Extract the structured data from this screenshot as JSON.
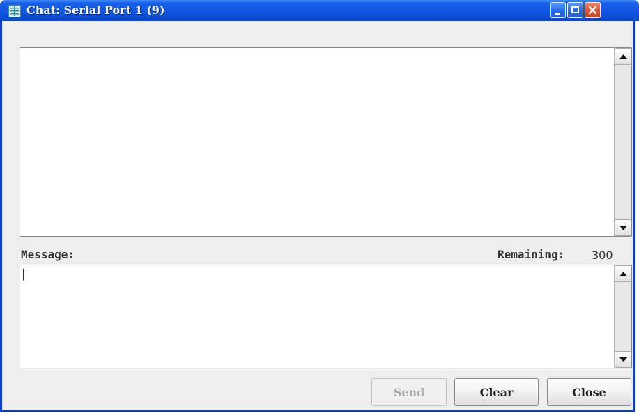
{
  "window": {
    "title": "Chat: Serial Port 1 (9)",
    "controls": [
      "minimize-icon",
      "maximize-icon",
      "close-icon"
    ],
    "accent_color": "#0f55e0",
    "close_color": "#e0572e"
  },
  "history": {
    "content": ""
  },
  "message": {
    "label": "Message:",
    "value": "",
    "remaining_label": "Remaining:",
    "remaining_value": "300"
  },
  "buttons": {
    "send": "Send",
    "clear": "Clear",
    "close": "Close"
  }
}
